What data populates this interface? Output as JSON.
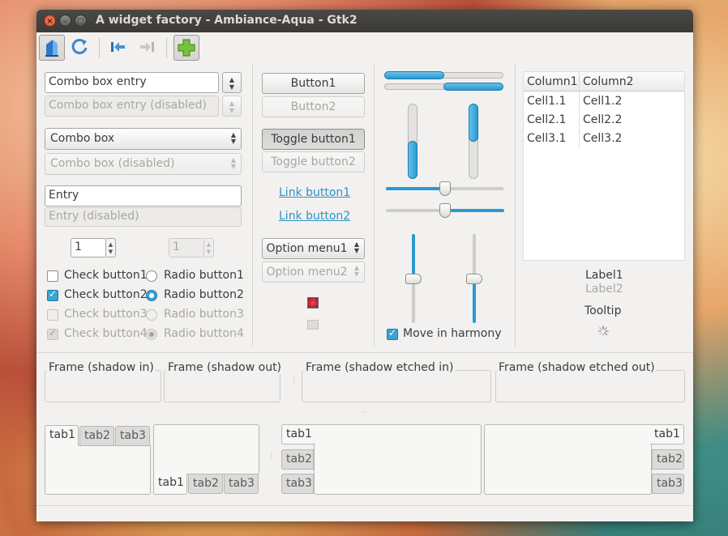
{
  "window": {
    "title": "A widget factory - Ambiance-Aqua - Gtk2"
  },
  "toolbar": {
    "items": [
      {
        "icon": "home-icon",
        "active": true
      },
      {
        "icon": "refresh-icon"
      },
      {
        "icon": "go-first-icon"
      },
      {
        "icon": "go-last-icon",
        "disabled": true
      },
      {
        "icon": "add-icon"
      }
    ]
  },
  "col1": {
    "combo_entry": "Combo box entry",
    "combo_entry_disabled": "Combo box entry (disabled)",
    "combo": "Combo box",
    "combo_disabled": "Combo box (disabled)",
    "entry": "Entry",
    "entry_disabled": "Entry (disabled)",
    "spin": "1",
    "spin_disabled": "1",
    "checks": [
      "Check button1",
      "Check button2",
      "Check button3",
      "Check button4"
    ],
    "radios": [
      "Radio button1",
      "Radio button2",
      "Radio button3",
      "Radio button4"
    ]
  },
  "col2": {
    "button1": "Button1",
    "button2": "Button2",
    "toggle1": "Toggle button1",
    "toggle2": "Toggle button2",
    "link1": "Link button1",
    "link2": "Link button2",
    "option1": "Option menu1",
    "option2": "Option menu2"
  },
  "col3": {
    "progress_h": [
      0.5,
      0.5
    ],
    "progress_v": [
      0.5,
      0.5
    ],
    "scale_h": [
      0.5,
      0.5
    ],
    "scale_v": [
      0.5,
      0.5
    ],
    "harmony": "Move in harmony"
  },
  "col4": {
    "tree": {
      "columns": [
        "Column1",
        "Column2"
      ],
      "rows": [
        [
          "Cell1.1",
          "Cell1.2"
        ],
        [
          "Cell2.1",
          "Cell2.2"
        ],
        [
          "Cell3.1",
          "Cell3.2"
        ]
      ]
    },
    "label1": "Label1",
    "label2": "Label2",
    "tooltip": "Tooltip"
  },
  "frames": [
    "Frame (shadow in)",
    "Frame (shadow out)",
    "Frame (shadow etched in)",
    "Frame (shadow etched out)"
  ],
  "tabs": [
    "tab1",
    "tab2",
    "tab3"
  ],
  "colors": {
    "accent": "#2a9ad2",
    "titlebar": "#3c3b37",
    "window_bg": "#f2f1f0"
  }
}
